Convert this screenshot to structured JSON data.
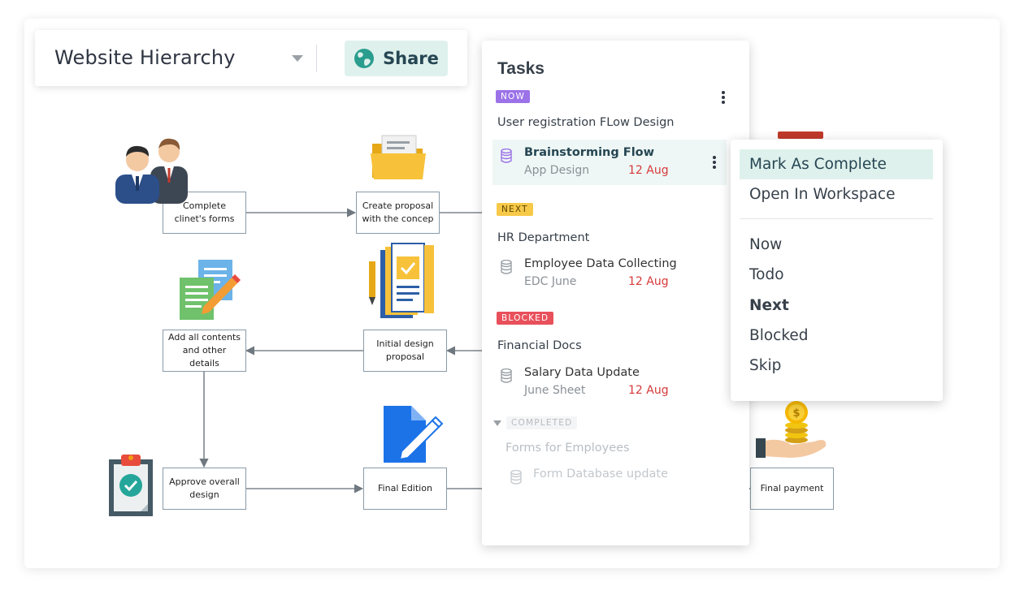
{
  "header": {
    "title": "Website Hierarchy",
    "share_label": "Share"
  },
  "flowchart": {
    "boxes": {
      "complete_forms": "Complete\nclinet's forms",
      "create_proposal": "Create proposal\nwith the concep",
      "add_contents": "Add all contents\nand other details",
      "initial_design": "Initial design\nproposal",
      "approve_design": "Approve overall\ndesign",
      "final_edition": "Final Edition",
      "final_payment": "Final  payment"
    }
  },
  "tasks": {
    "title": "Tasks",
    "now": {
      "badge": "NOW",
      "group": "User registration FLow Design",
      "item": {
        "name": "Brainstorming Flow",
        "sub": "App Design",
        "date": "12 Aug"
      }
    },
    "next": {
      "badge": "NEXT",
      "group": "HR Department",
      "item": {
        "name": "Employee Data Collecting",
        "sub": "EDC June",
        "date": "12 Aug"
      }
    },
    "blocked": {
      "badge": "BLOCKED",
      "group": "Financial Docs",
      "item": {
        "name": "Salary Data Update",
        "sub": "June Sheet",
        "date": "12 Aug"
      }
    },
    "completed": {
      "badge": "COMPLETED",
      "group": "Forms for Employees",
      "item": {
        "name": "Form Database update"
      }
    }
  },
  "context_menu": {
    "mark_complete": "Mark As Complete",
    "open_workspace": "Open In Workspace",
    "now": "Now",
    "todo": "Todo",
    "next": "Next",
    "blocked": "Blocked",
    "skip": "Skip"
  },
  "colors": {
    "accent_soft": "#dff1ec",
    "badge_now": "#9b72e8",
    "badge_next": "#f7c948",
    "badge_blocked": "#e8505b",
    "date_red": "#d63a3a"
  }
}
